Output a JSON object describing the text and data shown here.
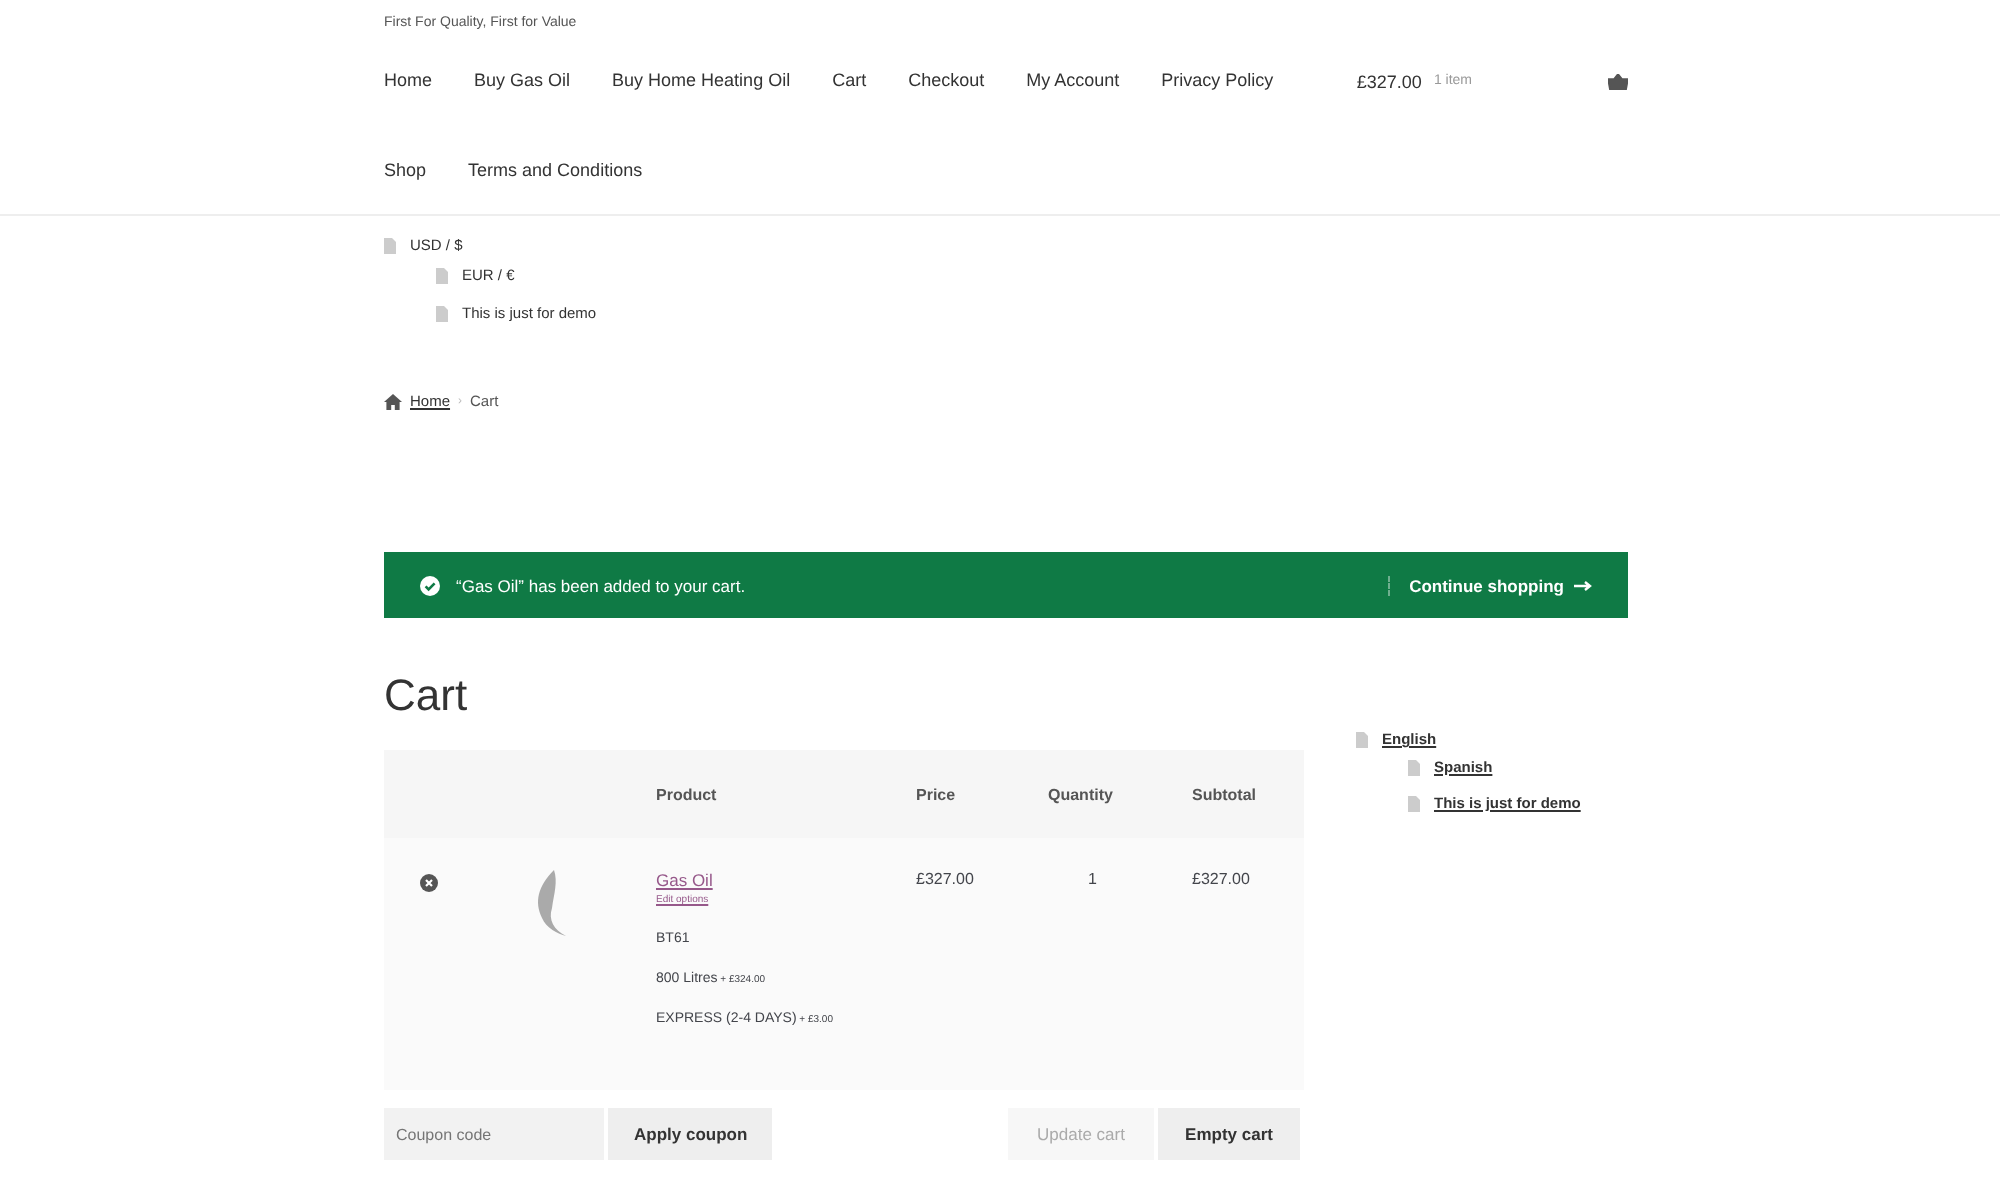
{
  "header": {
    "tagline": "First For Quality, First for Value",
    "nav": [
      {
        "label": "Home"
      },
      {
        "label": "Buy Gas Oil"
      },
      {
        "label": "Buy Home Heating Oil"
      },
      {
        "label": "Cart"
      },
      {
        "label": "Checkout"
      },
      {
        "label": "My Account"
      },
      {
        "label": "Privacy Policy"
      },
      {
        "label": "Shop"
      },
      {
        "label": "Terms and Conditions"
      }
    ],
    "cart_summary": {
      "amount": "£327.00",
      "count": "1 item"
    }
  },
  "currency_menu": [
    {
      "label": "USD / $",
      "children": [
        {
          "label": "EUR / €"
        },
        {
          "label": "This is just for demo"
        }
      ]
    }
  ],
  "breadcrumb_separator": "›",
  "breadcrumb": [
    {
      "label": "Home",
      "link": true
    },
    {
      "label": "Cart",
      "link": false
    }
  ],
  "notice": {
    "message": "“Gas Oil” has been added to your cart.",
    "action": "Continue shopping"
  },
  "page_title": "Cart",
  "table": {
    "columns": [
      "Product",
      "Price",
      "Quantity",
      "Subtotal"
    ],
    "rows": [
      {
        "product": "Gas Oil",
        "edit": "Edit options",
        "meta": [
          {
            "text": "BT61"
          },
          {
            "text": "800 Litres",
            "extra": "+ £324.00"
          },
          {
            "text": "EXPRESS (2-4 DAYS)",
            "extra": "+ £3.00"
          }
        ],
        "price": "£327.00",
        "quantity": "1",
        "subtotal": "£327.00"
      }
    ]
  },
  "actions": {
    "coupon_placeholder": "Coupon code",
    "apply": "Apply coupon",
    "update": {
      "label": "Update cart",
      "disabled": true
    },
    "empty": "Empty cart"
  },
  "language_menu": [
    {
      "label": "English",
      "children": [
        {
          "label": "Spanish"
        },
        {
          "label": "This is just for demo"
        }
      ]
    }
  ]
}
